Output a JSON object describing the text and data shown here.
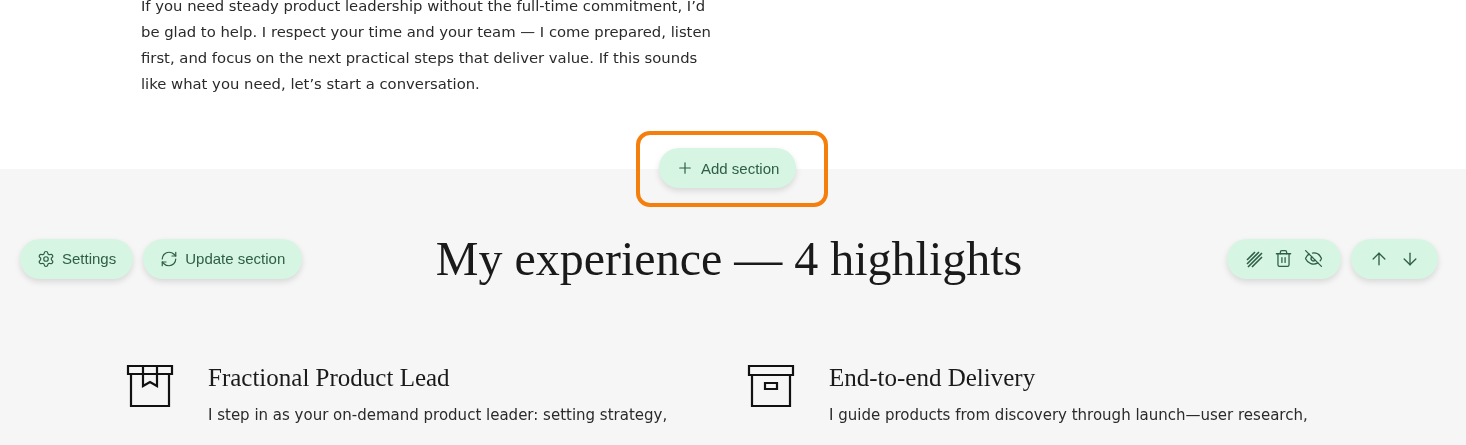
{
  "intro": {
    "text": "If you need steady product leadership without the full-time commitment, I’d be glad to help. I respect your time and your team — I come prepared, listen first, and focus on the next practical steps that deliver value. If this sounds like what you need, let’s start a conversation."
  },
  "add_section": {
    "label": "Add section",
    "highlighted": true
  },
  "section": {
    "left_buttons": [
      {
        "label": "Settings"
      },
      {
        "label": "Update section"
      }
    ],
    "title": "My experience — 4 highlights",
    "cards": [
      {
        "title": "Fractional Product Lead",
        "text": "I step in as your on-demand product leader: setting strategy,"
      },
      {
        "title": "End-to-end Delivery",
        "text": "I guide products from discovery through launch—user research,"
      }
    ]
  }
}
